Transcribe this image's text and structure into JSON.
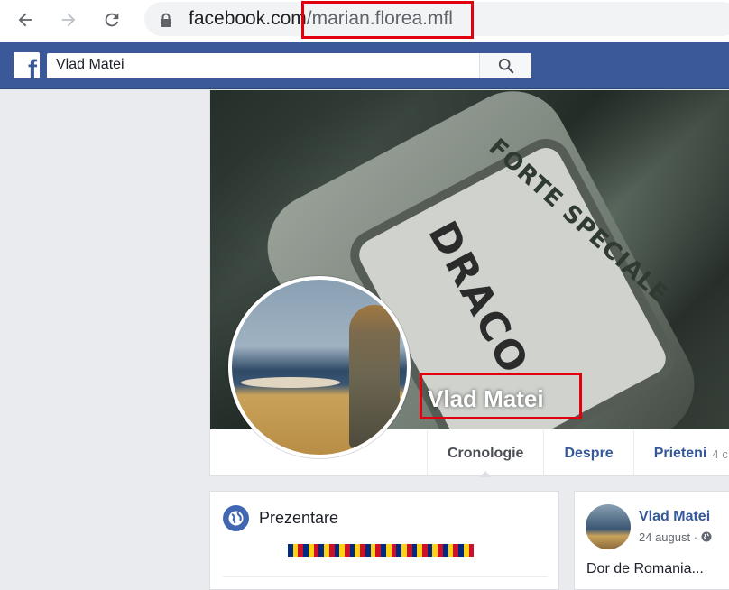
{
  "browser": {
    "url_domain": "facebook.com",
    "url_path": "/marian.florea.mfl"
  },
  "fb": {
    "logo_letter": "f",
    "search_value": "Vlad Matei"
  },
  "profile": {
    "name": "Vlad Matei",
    "cover_patch_text": "DRACO",
    "cover_arc_text": "FORTE SPECIALE",
    "tabs": [
      {
        "label": "Cronologie",
        "active": true
      },
      {
        "label": "Despre"
      },
      {
        "label": "Prieteni",
        "count": "4 c"
      }
    ]
  },
  "intro": {
    "title": "Prezentare",
    "flag_count": 12,
    "flag_colors": [
      "#002b7f",
      "#fcd116",
      "#ce1126"
    ]
  },
  "post": {
    "author": "Vlad Matei",
    "date": "24 august · ",
    "text": "Dor de Romania..."
  },
  "colors": {
    "fb_blue": "#3b5998",
    "link": "#365899",
    "highlight": "#e2000f"
  }
}
